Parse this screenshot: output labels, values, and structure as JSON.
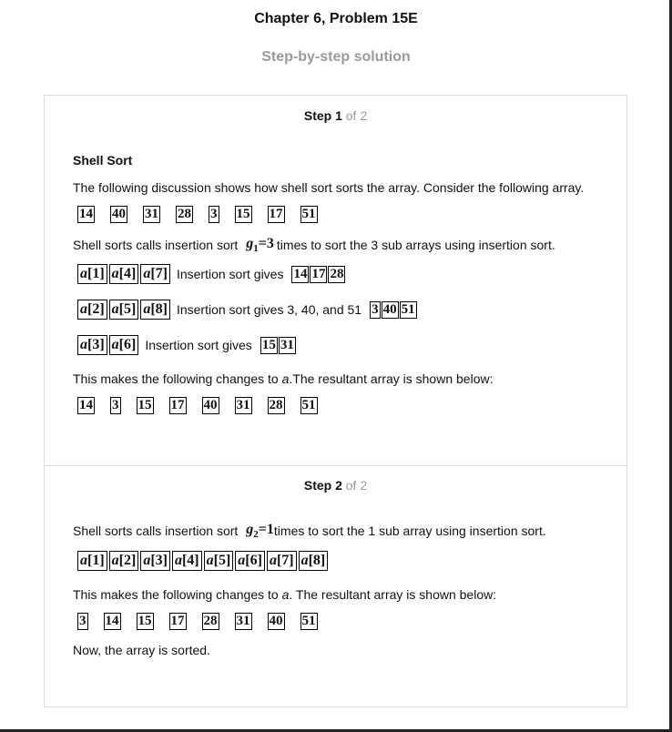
{
  "header": {
    "chapter_title": "Chapter 6, Problem 15E",
    "subtitle": "Step-by-step solution"
  },
  "step1": {
    "label": "Step 1",
    "of": "of 2",
    "section_title": "Shell Sort",
    "intro": "The following discussion shows how shell sort sorts the array. Consider the following array.",
    "initial_array": [
      "14",
      "40",
      "31",
      "28",
      "3",
      "15",
      "17",
      "51"
    ],
    "gap_text_before": "Shell sorts calls insertion sort",
    "gap_var": "g",
    "gap_sub": "1",
    "gap_eq": "=3",
    "gap_text_after": "times to sort the 3 sub arrays using insertion sort.",
    "subarrays": [
      {
        "elements": [
          "a[1]",
          "a[4]",
          "a[7]"
        ],
        "text": "Insertion sort gives",
        "result": [
          "14",
          "17",
          "28"
        ]
      },
      {
        "elements": [
          "a[2]",
          "a[5]",
          "a[8]"
        ],
        "text": "Insertion sort gives 3, 40, and 51",
        "result": [
          "3",
          "40",
          "51"
        ]
      },
      {
        "elements": [
          "a[3]",
          "a[6]"
        ],
        "text": "Insertion sort gives",
        "result": [
          "15",
          "31"
        ]
      }
    ],
    "changes_before": "This makes the following changes to ",
    "changes_var": "a",
    "changes_after": ".The resultant array is shown below:",
    "result_array": [
      "14",
      "3",
      "15",
      "17",
      "40",
      "31",
      "28",
      "51"
    ]
  },
  "step2": {
    "label": "Step 2",
    "of": "of 2",
    "gap_text_before": "Shell sorts calls insertion sort",
    "gap_var": "g",
    "gap_sub": "2",
    "gap_eq": "=1",
    "gap_text_after": "times to sort the 1 sub array using insertion sort.",
    "elements": [
      "a[1]",
      "a[2]",
      "a[3]",
      "a[4]",
      "a[5]",
      "a[6]",
      "a[7]",
      "a[8]"
    ],
    "changes_before": "This makes the following changes to ",
    "changes_var": "a",
    "changes_after": ". The resultant array is shown below:",
    "result_array": [
      "3",
      "14",
      "15",
      "17",
      "28",
      "31",
      "40",
      "51"
    ],
    "conclusion": "Now, the array is sorted."
  }
}
